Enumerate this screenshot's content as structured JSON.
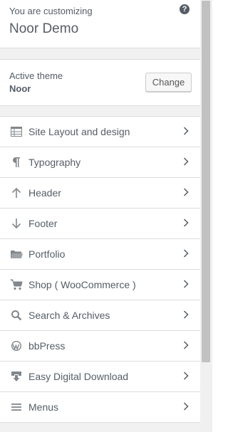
{
  "header": {
    "customizing_label": "You are customizing",
    "site_title": "Noor Demo",
    "help_glyph": "?"
  },
  "theme": {
    "label": "Active theme",
    "name": "Noor",
    "change_label": "Change"
  },
  "menu": {
    "items": [
      {
        "label": "Site Layout and design",
        "icon": "layout-icon"
      },
      {
        "label": "Typography",
        "icon": "paragraph-icon"
      },
      {
        "label": "Header",
        "icon": "arrow-up-icon"
      },
      {
        "label": "Footer",
        "icon": "arrow-down-icon"
      },
      {
        "label": "Portfolio",
        "icon": "portfolio-icon"
      },
      {
        "label": "Shop ( WooCommerce )",
        "icon": "cart-icon"
      },
      {
        "label": "Search & Archives",
        "icon": "search-icon"
      },
      {
        "label": "bbPress",
        "icon": "wordpress-icon"
      },
      {
        "label": "Easy Digital Download",
        "icon": "download-icon"
      },
      {
        "label": "Menus",
        "icon": "menu-icon"
      }
    ]
  },
  "colors": {
    "text": "#555d66",
    "icon": "#82878c",
    "panel_bg": "#f1f1f1",
    "border": "#dddddd"
  }
}
